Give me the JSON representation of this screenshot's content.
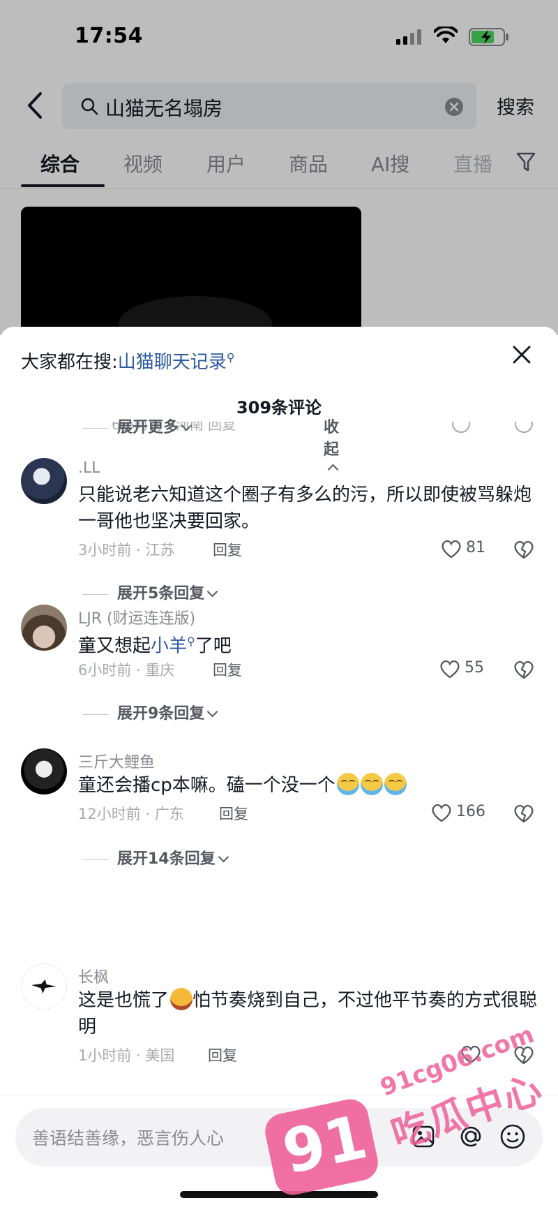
{
  "status_bar": {
    "time": "17:54"
  },
  "search": {
    "query": "山猫无名塌房",
    "submit_label": "搜索"
  },
  "tabs": [
    {
      "label": "综合",
      "active": true
    },
    {
      "label": "视频"
    },
    {
      "label": "用户"
    },
    {
      "label": "商品"
    },
    {
      "label": "AI搜"
    },
    {
      "label": "直播"
    }
  ],
  "sheet": {
    "hot_search_prefix": "大家都在搜:",
    "hot_search_keyword": "山猫聊天记录",
    "comment_count": "309条评论",
    "ghost_meta": "6小时前 · 河南   回复",
    "expand_more": "展开更多",
    "collapse": "收起"
  },
  "comments": [
    {
      "username": ".LL",
      "text": "只能说老六知道这个圈子有多么的污，所以即使被骂躲炮一哥他也坚决要回家。",
      "meta": "3小时前 · 江苏",
      "reply": "回复",
      "likes": "81",
      "expand": "展开5条回复"
    },
    {
      "username": "LJR (财运连连版)",
      "text_before": "童又想起",
      "link": "小羊",
      "text_after": "了吧",
      "meta": "6小时前 · 重庆",
      "reply": "回复",
      "likes": "55",
      "expand": "展开9条回复"
    },
    {
      "username": "三斤大鲤鱼",
      "text": "童还会播cp本嘛。磕一个没一个",
      "emoji": "loudly-crying-face x3",
      "meta": "12小时前 · 广东",
      "reply": "回复",
      "likes": "166",
      "expand": "展开14条回复"
    },
    {
      "username": "长枫",
      "text_before": "这是也慌了",
      "emoji": "rolling-on-floor-laughing",
      "text_after": "怕节奏烧到自己，不过他平节奏的方式很聪明",
      "meta": "1小时前 · 美国",
      "reply": "回复"
    }
  ],
  "input": {
    "placeholder": "善语结善缘，恶言伤人心"
  },
  "watermark": {
    "number": "91",
    "url": "91cg06.com",
    "text": "吃瓜中心"
  },
  "colors": {
    "link": "#2c5aa0",
    "watermark": "#f0609a",
    "text_primary": "#161823",
    "text_secondary": "#8a8b91"
  }
}
